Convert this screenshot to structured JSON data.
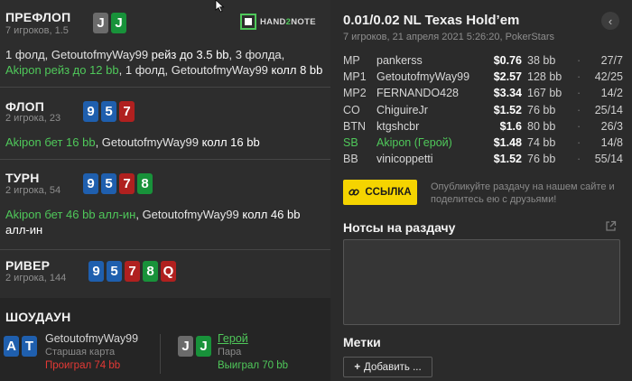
{
  "brand": {
    "logo_text_left": "HAND",
    "logo_text_num": "2",
    "logo_text_right": "NOTE"
  },
  "streets": {
    "preflop": {
      "title": "ПРЕФЛОП",
      "sub": "7 игроков, 1.5",
      "cards": [
        "J",
        "J"
      ],
      "action": {
        "p1": "1 фолд, GetoutofmyWay99 ",
        "p2": "рейз до 3.5 bb",
        "p3": ", 3 фолда, ",
        "hero1": "Akipon рейз до 12 bb",
        "p4": ", 1 фолд, GetoutofmyWay99 ",
        "p5": "колл 8 bb"
      }
    },
    "flop": {
      "title": "ФЛОП",
      "sub": "2 игрока, 23",
      "cards": [
        "9",
        "5",
        "7"
      ],
      "action": {
        "hero1": "Akipon бет 16 bb",
        "p1": ", GetoutofmyWay99 ",
        "p2": "колл 16 bb"
      }
    },
    "turn": {
      "title": "ТУРН",
      "sub": "2 игрока, 54",
      "cards": [
        "9",
        "5",
        "7",
        "8"
      ],
      "action": {
        "hero1": "Akipon бет 46 bb алл-ин",
        "p1": ", GetoutofmyWay99 ",
        "p2": "колл 46 bb алл-ин"
      }
    },
    "river": {
      "title": "РИВЕР",
      "sub": "2 игрока, 144",
      "cards": [
        "9",
        "5",
        "7",
        "8",
        "Q"
      ]
    }
  },
  "showdown": {
    "title": "ШОУДАУН",
    "villain": {
      "cards": [
        "A",
        "T"
      ],
      "name": "GetoutofmyWay99",
      "hand": "Старшая карта",
      "result": "Проиграл 74 bb"
    },
    "hero": {
      "cards": [
        "J",
        "J"
      ],
      "name": "Герой",
      "hand": "Пара",
      "result": "Выиграл 70 bb"
    }
  },
  "game": {
    "title": "0.01/0.02 NL Texas Hold’em",
    "sub": "7 игроков, 21 апреля 2021 5:26:20, PokerStars"
  },
  "players": [
    {
      "pos": "MP",
      "name": "pankerss",
      "stack": "$0.76",
      "bb": "38 bb",
      "sep": "·",
      "ratio": "27/7"
    },
    {
      "pos": "MP1",
      "name": "GetoutofmyWay99",
      "stack": "$2.57",
      "bb": "128 bb",
      "sep": "·",
      "ratio": "42/25"
    },
    {
      "pos": "MP2",
      "name": "FERNANDO428",
      "stack": "$3.34",
      "bb": "167 bb",
      "sep": "·",
      "ratio": "14/2"
    },
    {
      "pos": "CO",
      "name": "ChiguireJr",
      "stack": "$1.52",
      "bb": "76 bb",
      "sep": "·",
      "ratio": "25/14"
    },
    {
      "pos": "BTN",
      "name": "ktgshcbr",
      "stack": "$1.6",
      "bb": "80 bb",
      "sep": "·",
      "ratio": "26/3"
    },
    {
      "pos": "SB",
      "name": "Akipon (Герой)",
      "stack": "$1.48",
      "bb": "74 bb",
      "sep": "·",
      "ratio": "14/8"
    },
    {
      "pos": "BB",
      "name": "vinicoppetti",
      "stack": "$1.52",
      "bb": "76 bb",
      "sep": "·",
      "ratio": "55/14"
    }
  ],
  "share": {
    "button": "ССЫЛКА",
    "text": "Опубликуйте раздачу на нашем сайте и поделитесь ею с друзьями!"
  },
  "notes": {
    "title": "Нотсы на раздачу",
    "value": ""
  },
  "tags": {
    "title": "Метки",
    "add_button": "Добавить ..."
  },
  "colors": {
    "accent": "#f5d400",
    "hero_green": "#4fc85a",
    "lose_red": "#e53935",
    "card_blue": "#1f5fae",
    "card_red": "#b0201f",
    "card_green": "#18923a",
    "card_gray": "#6b6b6b"
  },
  "icons": [
    "link-icon",
    "external-link-icon",
    "back-arrow-icon",
    "plus-icon",
    "cursor-icon"
  ]
}
